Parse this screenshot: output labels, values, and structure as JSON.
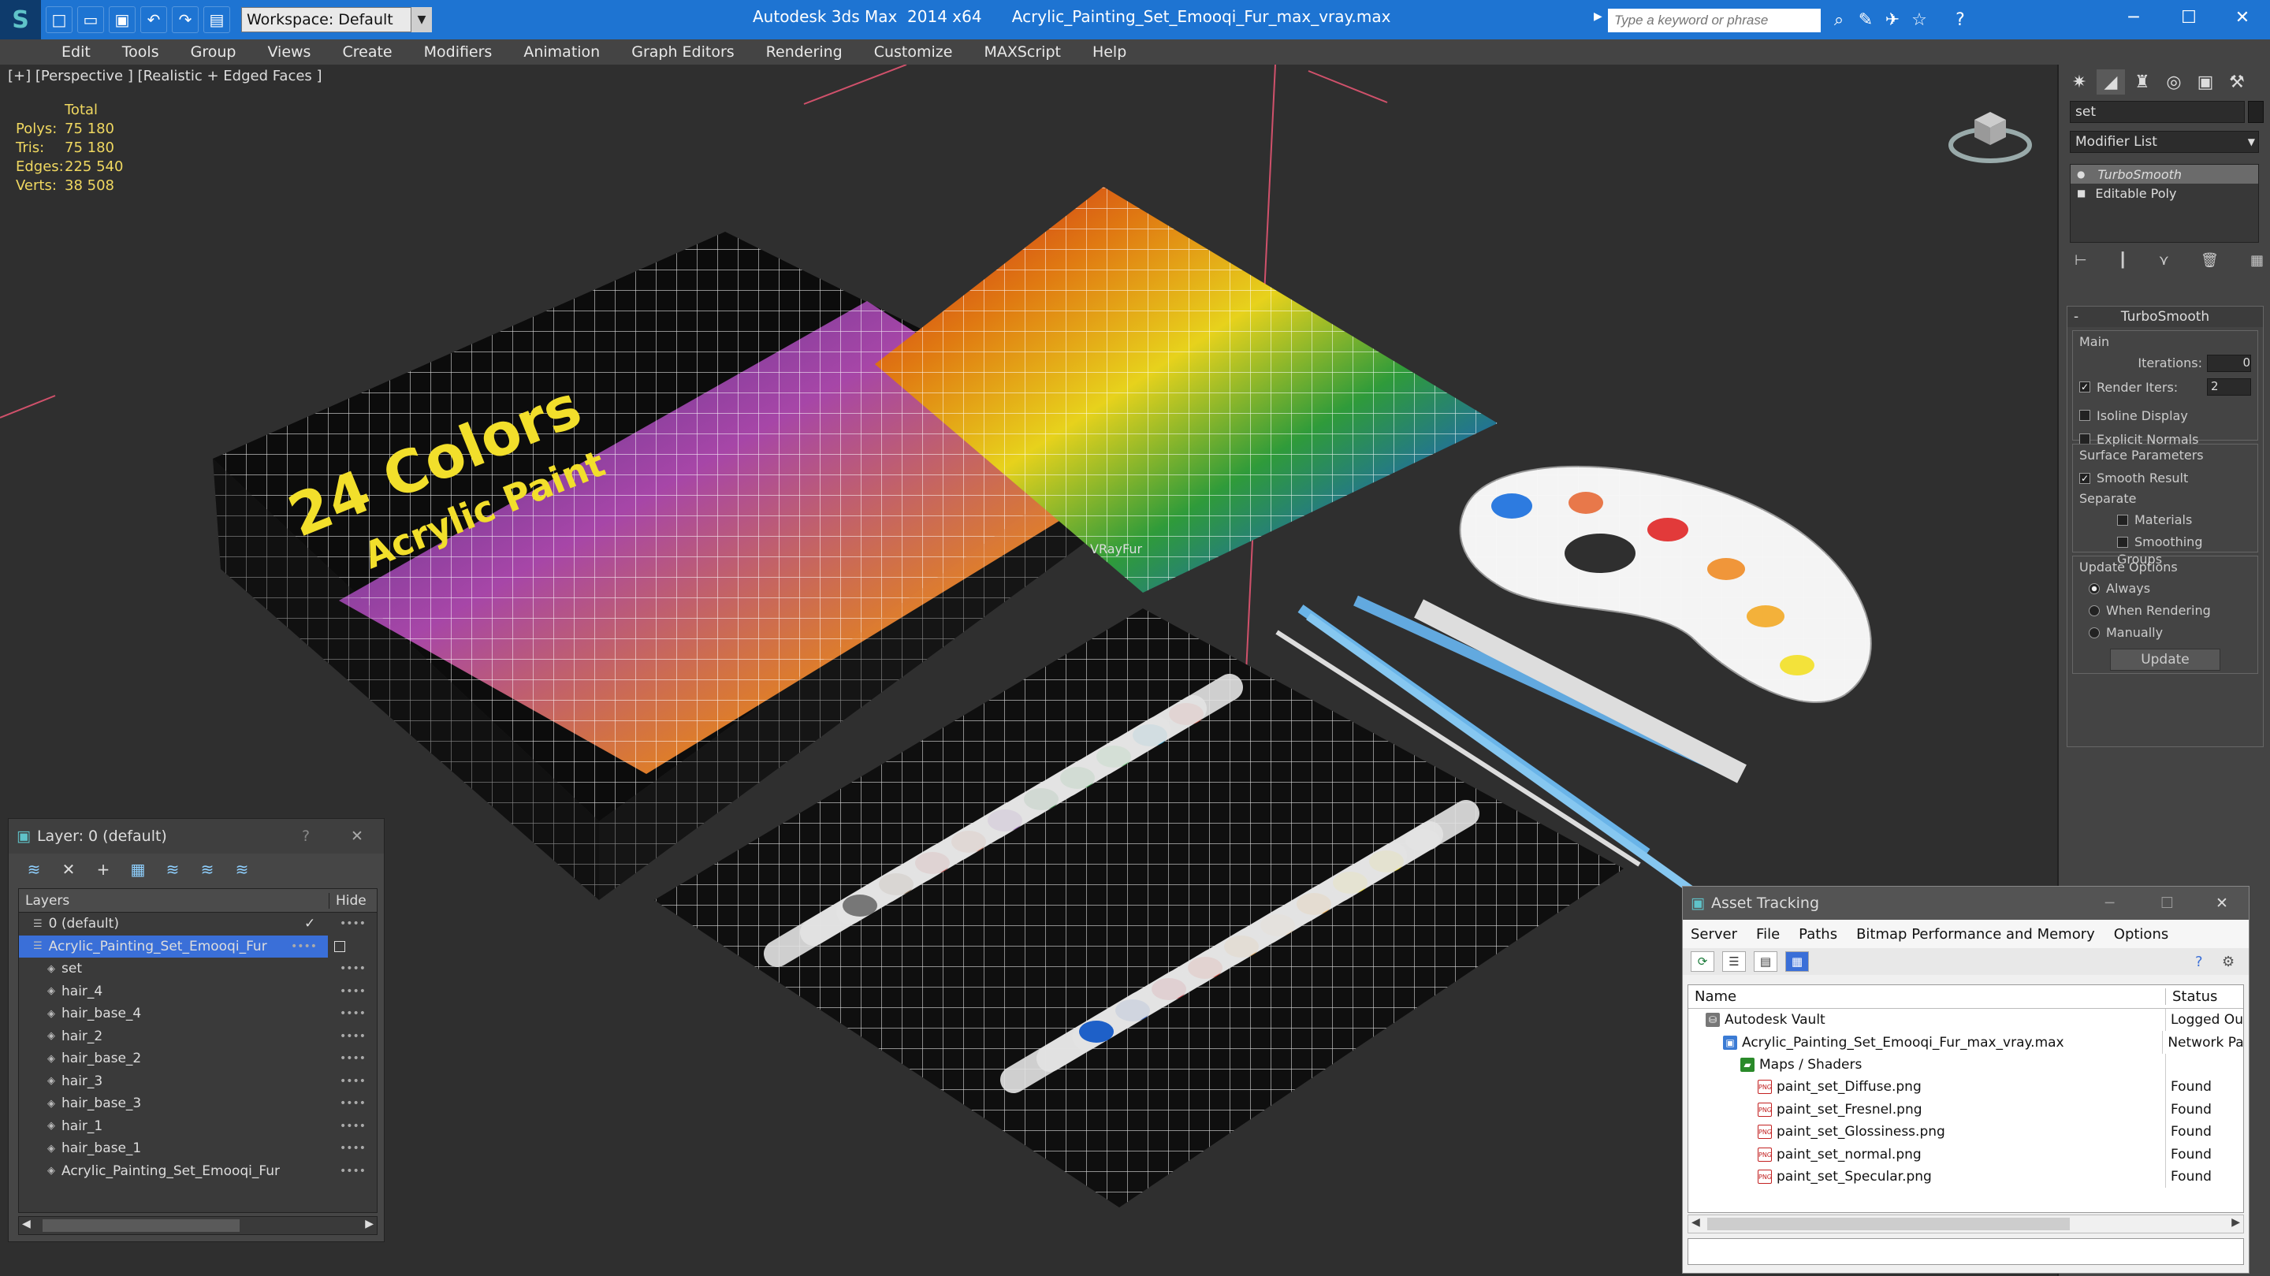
{
  "titlebar": {
    "workspace": "Workspace: Default",
    "title": "Autodesk 3ds Max  2014 x64      Acrylic_Painting_Set_Emooqi_Fur_max_vray.max",
    "search_placeholder": "Type a keyword or phrase"
  },
  "menu": [
    "Edit",
    "Tools",
    "Group",
    "Views",
    "Create",
    "Modifiers",
    "Animation",
    "Graph Editors",
    "Rendering",
    "Customize",
    "MAXScript",
    "Help"
  ],
  "viewport": {
    "label": "[+] [Perspective ] [Realistic + Edged Faces ]",
    "stats": {
      "header": "Total",
      "rows": [
        {
          "k": "Polys:",
          "v": "75 180"
        },
        {
          "k": "Tris:",
          "v": "75 180"
        },
        {
          "k": "Edges:",
          "v": "225 540"
        },
        {
          "k": "Verts:",
          "v": "38 508"
        }
      ]
    },
    "box_text_main": "24 Colors",
    "box_text_sub": "Acrylic Paint",
    "vray_label": "VRayFur"
  },
  "command_panel": {
    "object_name": "set",
    "modifier_list": "Modifier List",
    "stack": [
      "TurboSmooth",
      "Editable Poly"
    ],
    "rollout_title": "TurboSmooth",
    "main_label": "Main",
    "iterations_label": "Iterations:",
    "iterations_value": "0",
    "render_iters_label": "Render Iters:",
    "render_iters_value": "2",
    "isoline": "Isoline Display",
    "explicit_normals": "Explicit Normals",
    "surface_params": "Surface Parameters",
    "smooth_result": "Smooth Result",
    "separate": "Separate",
    "materials": "Materials",
    "smoothing_groups": "Smoothing Groups",
    "update_options": "Update Options",
    "always": "Always",
    "when_rendering": "When Rendering",
    "manually": "Manually",
    "update_button": "Update"
  },
  "layer_panel": {
    "title": "Layer: 0 (default)",
    "help": "?",
    "col_layers": "Layers",
    "col_hide": "Hide",
    "rows": [
      {
        "name": "0 (default)",
        "indent": 1
      },
      {
        "name": "Acrylic_Painting_Set_Emooqi_Fur",
        "indent": 1,
        "selected": true
      },
      {
        "name": "set",
        "indent": 2
      },
      {
        "name": "hair_4",
        "indent": 2
      },
      {
        "name": "hair_base_4",
        "indent": 2
      },
      {
        "name": "hair_2",
        "indent": 2
      },
      {
        "name": "hair_base_2",
        "indent": 2
      },
      {
        "name": "hair_3",
        "indent": 2
      },
      {
        "name": "hair_base_3",
        "indent": 2
      },
      {
        "name": "hair_1",
        "indent": 2
      },
      {
        "name": "hair_base_1",
        "indent": 2
      },
      {
        "name": "Acrylic_Painting_Set_Emooqi_Fur",
        "indent": 2
      }
    ]
  },
  "asset_tracking": {
    "title": "Asset Tracking",
    "menu": [
      "Server",
      "File",
      "Paths",
      "Bitmap Performance and Memory",
      "Options"
    ],
    "col_name": "Name",
    "col_status": "Status",
    "rows": [
      {
        "name": "Autodesk Vault",
        "status": "Logged Ou",
        "indent": 1,
        "icon": "vault"
      },
      {
        "name": "Acrylic_Painting_Set_Emooqi_Fur_max_vray.max",
        "status": "Network Pa",
        "indent": 2,
        "icon": "max"
      },
      {
        "name": "Maps / Shaders",
        "status": "",
        "indent": 3,
        "icon": "maps"
      },
      {
        "name": "paint_set_Diffuse.png",
        "status": "Found",
        "indent": 4,
        "icon": "png"
      },
      {
        "name": "paint_set_Fresnel.png",
        "status": "Found",
        "indent": 4,
        "icon": "png"
      },
      {
        "name": "paint_set_Glossiness.png",
        "status": "Found",
        "indent": 4,
        "icon": "png"
      },
      {
        "name": "paint_set_normal.png",
        "status": "Found",
        "indent": 4,
        "icon": "png"
      },
      {
        "name": "paint_set_Specular.png",
        "status": "Found",
        "indent": 4,
        "icon": "png"
      }
    ]
  },
  "colors": {
    "titlebar": "#1e74d2",
    "stats": "#f0d860",
    "selection": "#3a6fd8"
  }
}
